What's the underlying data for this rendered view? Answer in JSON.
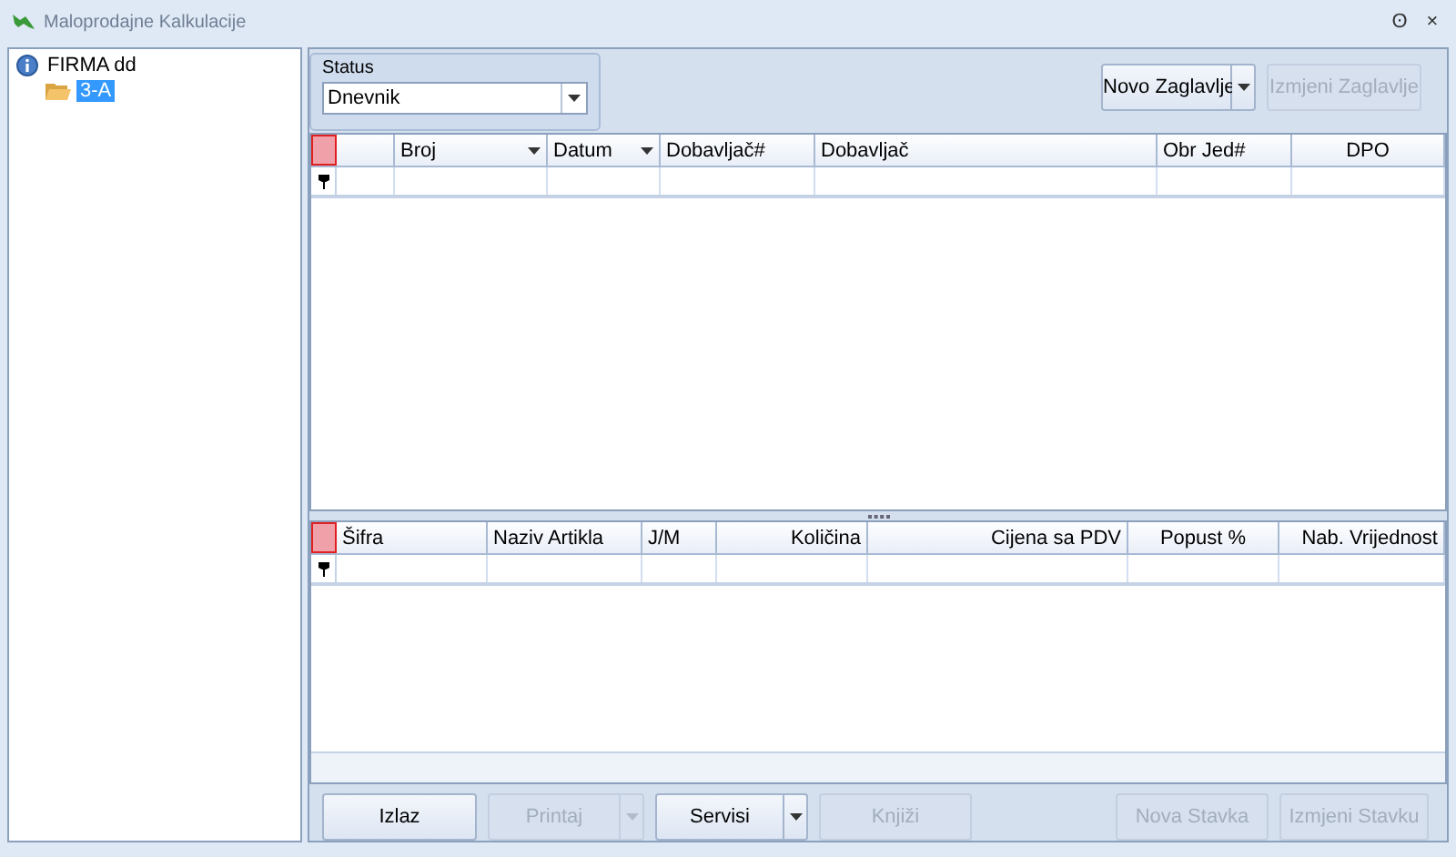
{
  "window": {
    "title": "Maloprodajne Kalkulacije",
    "pin": "ʘ",
    "close": "×"
  },
  "tree": [
    {
      "label": "FIRMA dd",
      "kind": "root",
      "selected": false,
      "children": [
        {
          "label": "3-A",
          "kind": "folder",
          "selected": true
        }
      ]
    }
  ],
  "status": {
    "label": "Status",
    "value": "Dnevnik"
  },
  "header_buttons": [
    {
      "label": "Novo Zaglavlje",
      "disabled": false,
      "split": true
    },
    {
      "label": "Izmjeni Zaglavlje",
      "disabled": true,
      "split": false
    }
  ],
  "header_table": {
    "columns": [
      {
        "label": "Broj",
        "sort": true
      },
      {
        "label": "Datum",
        "sort": true
      },
      {
        "label": "Dobavljač#",
        "sort": false
      },
      {
        "label": "Dobavljač",
        "sort": false
      },
      {
        "label": "Obr Jed#",
        "sort": false
      },
      {
        "label": "DPO",
        "sort": false
      }
    ]
  },
  "items_table": {
    "columns": [
      {
        "label": "Šifra",
        "sort": false
      },
      {
        "label": "Naziv Artikla",
        "sort": false
      },
      {
        "label": "J/M",
        "sort": false
      },
      {
        "label": "Količina",
        "sort": false
      },
      {
        "label": "Cijena sa PDV",
        "sort": false
      },
      {
        "label": "Popust %",
        "sort": false
      },
      {
        "label": "Nab. Vrijednost",
        "sort": false
      }
    ]
  },
  "footer_buttons": [
    {
      "label": "Izlaz",
      "disabled": false,
      "split": false
    },
    {
      "label": "Printaj",
      "disabled": true,
      "split": true
    },
    {
      "label": "Servisi",
      "disabled": false,
      "split": true
    },
    {
      "label": "Knjiži",
      "disabled": true,
      "split": false
    },
    {
      "label": "Nova Stavka",
      "disabled": true,
      "split": false
    },
    {
      "label": "Izmjeni Stavku",
      "disabled": true,
      "split": false
    }
  ]
}
